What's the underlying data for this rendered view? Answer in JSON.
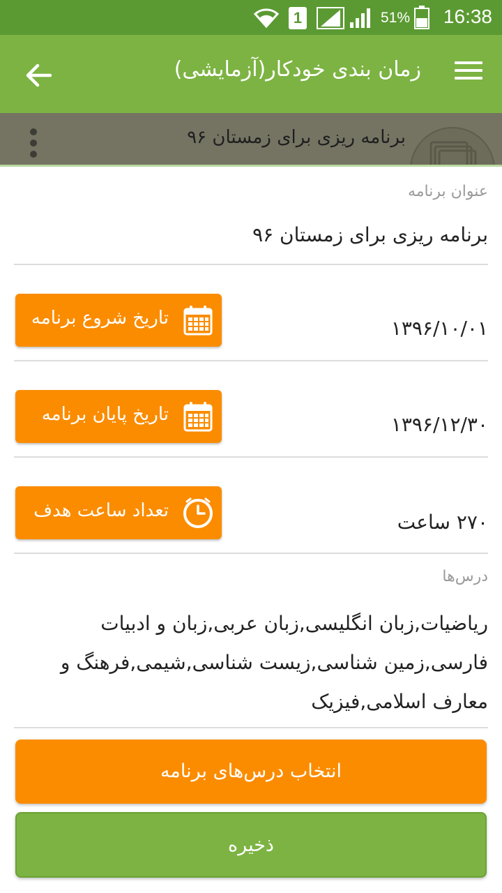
{
  "status_bar": {
    "battery_percent": "51%",
    "time": "16:38",
    "sim_slot": "1",
    "icons": [
      "wifi-icon",
      "sim-icon",
      "signal-icon",
      "signal-icon-2",
      "battery-icon"
    ]
  },
  "app_bar": {
    "title": "زمان بندی خودکار(آزمایشی)",
    "icons": [
      "back-arrow-icon",
      "hamburger-menu-icon"
    ]
  },
  "sub_header": {
    "title": "برنامه ریزی برای زمستان ۹۶",
    "icons": [
      "more-vert-icon",
      "stacked-cards-icon"
    ]
  },
  "program_title": {
    "label": "عنوان برنامه",
    "value": "برنامه ریزی برای زمستان ۹۶"
  },
  "start_date": {
    "button_label": "تاریخ شروع برنامه",
    "value": "۱۳۹۶/۱۰/۰۱",
    "icon": "calendar-icon"
  },
  "end_date": {
    "button_label": "تاریخ پایان برنامه",
    "value": "۱۳۹۶/۱۲/۳۰",
    "icon": "calendar-icon"
  },
  "target_hours": {
    "button_label": "تعداد ساعت هدف",
    "value": "۲۷۰ ساعت",
    "icon": "clock-icon"
  },
  "lessons": {
    "label": "درس‌ها",
    "value": "ریاضیات,زبان انگلیسی,زبان عربی,زبان و ادبیات فارسی,زمین شناسی,زیست شناسی,شیمی,فرهنگ و معارف اسلامی,فیزیک"
  },
  "actions": {
    "select_lessons": "انتخاب درس‌های برنامه",
    "save": "ذخیره"
  },
  "colors": {
    "status_bar": "#5b9a32",
    "app_bar": "#7cb342",
    "sub_header": "#757463",
    "orange": "#fb8c00",
    "green": "#7cb342"
  }
}
